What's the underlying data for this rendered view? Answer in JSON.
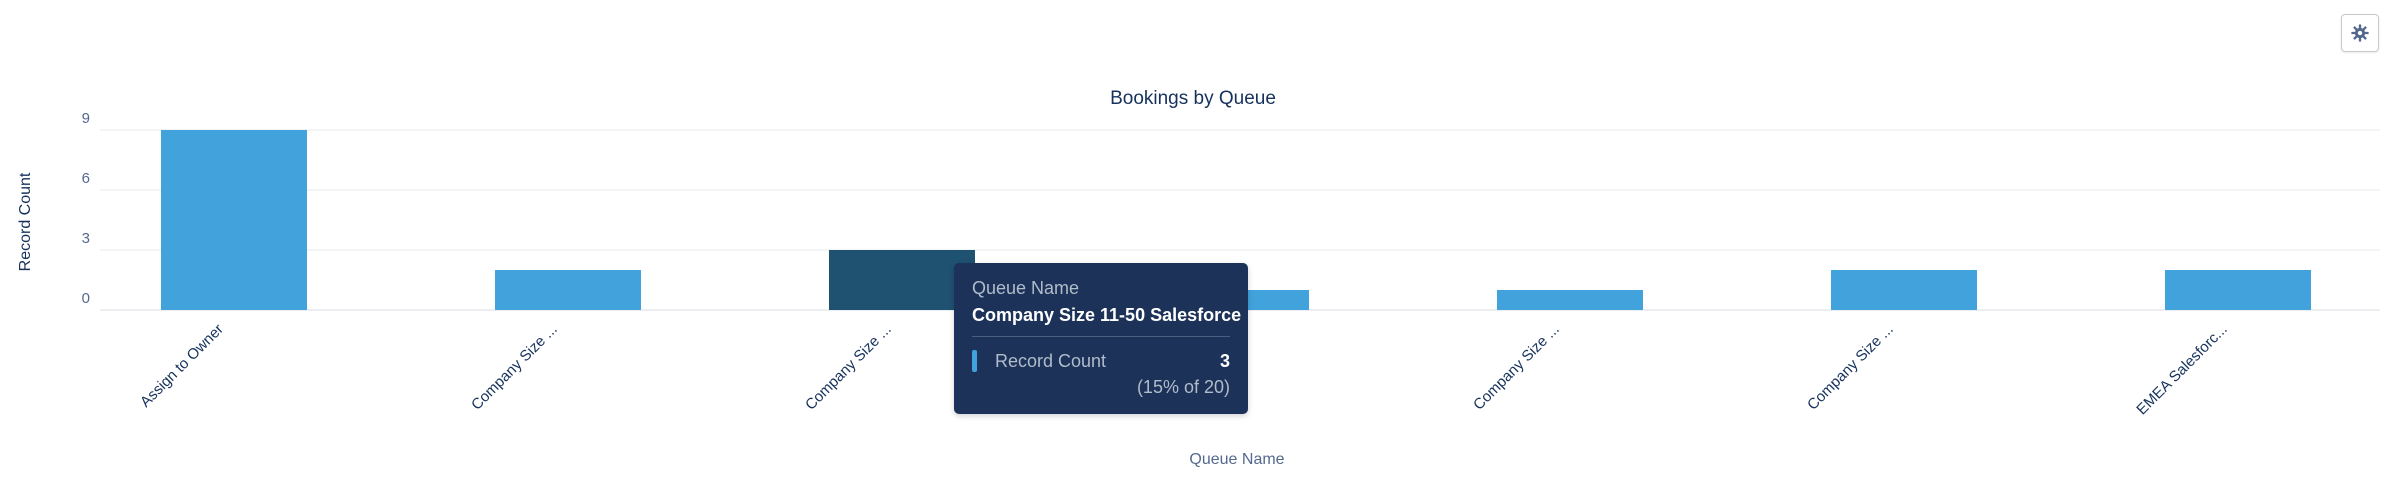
{
  "colors": {
    "bar": "#42a2dc",
    "bar_highlight": "#1f5171",
    "tooltip_bg": "#1c3259"
  },
  "settings": {
    "icon": "gear-icon"
  },
  "chart_data": {
    "type": "bar",
    "title": "Bookings by Queue",
    "xlabel": "Queue Name",
    "ylabel": "Record Count",
    "categories": [
      "Assign to Owner",
      "Company Size ...",
      "Company Size ...",
      "Company Size ...",
      "Company Size ...",
      "Company Size ...",
      "EMEA Salesforc..."
    ],
    "values": [
      9,
      2,
      3,
      1,
      1,
      2,
      2
    ],
    "highlight_index": 2,
    "ylim": [
      0,
      9
    ],
    "yticks": [
      "0",
      "3",
      "6",
      "9"
    ],
    "grid": true,
    "legend": "none"
  },
  "tooltip": {
    "dimension_label": "Queue Name",
    "dimension_value": "Company Size 11-50 Salesforce",
    "measure_label": "Record Count",
    "measure_value": "3",
    "percent": "(15% of 20)"
  }
}
